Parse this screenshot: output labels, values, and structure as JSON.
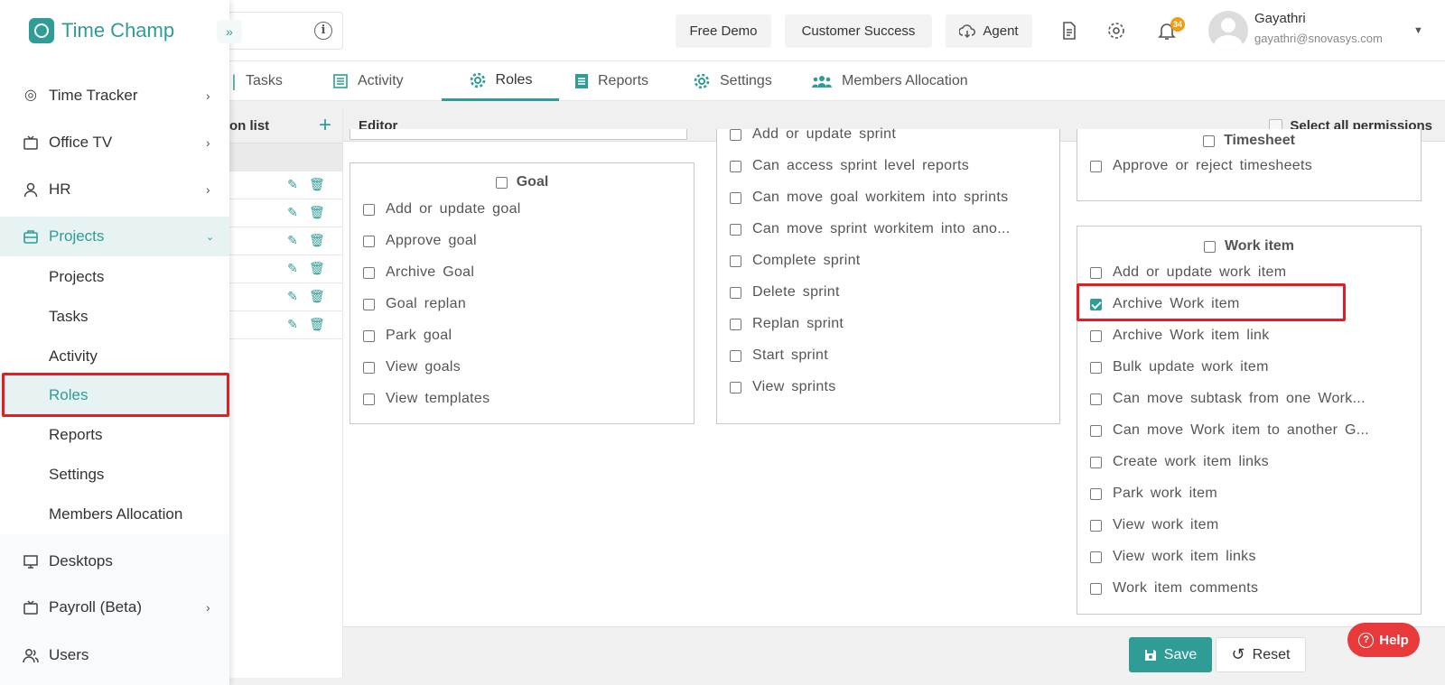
{
  "app": {
    "name": "Time Champ"
  },
  "header": {
    "free_demo": "Free Demo",
    "customer_success": "Customer Success",
    "agent": "Agent",
    "notification_count": "34",
    "user_name": "Gayathri",
    "user_email": "gayathri@snovasys.com"
  },
  "tabs": [
    "Tasks",
    "Activity",
    "Roles",
    "Reports",
    "Settings",
    "Members Allocation"
  ],
  "sidebar": {
    "items": [
      {
        "label": "Time Tracker"
      },
      {
        "label": "Office TV"
      },
      {
        "label": "HR"
      },
      {
        "label": "Projects"
      },
      {
        "label": "Desktops"
      },
      {
        "label": "Payroll (Beta)"
      },
      {
        "label": "Users"
      }
    ],
    "sub_items": [
      "Projects",
      "Tasks",
      "Activity",
      "Roles",
      "Reports",
      "Settings",
      "Members Allocation"
    ],
    "selected_sub": "Roles"
  },
  "role_list": {
    "title": "on list"
  },
  "editor": {
    "title": "Editor",
    "select_all": "Select all permissions",
    "goal": {
      "title": "Goal",
      "items": [
        "Add or update goal",
        "Approve goal",
        "Archive Goal",
        "Goal replan",
        "Park goal",
        "View goals",
        "View templates"
      ]
    },
    "sprint": {
      "items": [
        "Add or update sprint",
        "Can access sprint level reports",
        "Can move goal workitem into sprints",
        "Can move sprint workitem into ano...",
        "Complete sprint",
        "Delete sprint",
        "Replan sprint",
        "Start sprint",
        "View sprints"
      ]
    },
    "timesheet": {
      "title": "Timesheet",
      "items": [
        "Approve or reject timesheets"
      ]
    },
    "work_item": {
      "title": "Work item",
      "items": [
        "Add or update work item",
        "Archive Work item",
        "Archive Work item link",
        "Bulk update work item",
        "Can move subtask from one Work...",
        "Can move Work item to another G...",
        "Create work item links",
        "Park work item",
        "View work item",
        "View work item links",
        "Work item comments"
      ],
      "checked_item": "Archive Work item"
    }
  },
  "buttons": {
    "save": "Save",
    "reset": "Reset",
    "help": "Help"
  },
  "colors": {
    "accent": "#2f9c95",
    "highlight": "#e51c23",
    "help": "#e8393b"
  }
}
